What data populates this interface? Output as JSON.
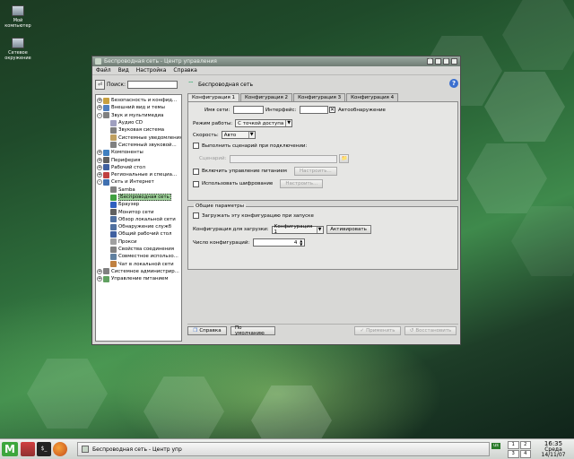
{
  "desktop": {
    "icons": [
      {
        "label": "Мой компьютер",
        "icon": "computer-icon"
      },
      {
        "label": "Сетевое окружение",
        "icon": "network-icon"
      }
    ]
  },
  "window": {
    "title": "Беспроводная сеть - Центр управления",
    "menu": [
      "Файл",
      "Вид",
      "Настройка",
      "Справка"
    ]
  },
  "sidebar": {
    "search_label": "Поиск:",
    "search_value": "",
    "tree": [
      {
        "label": "Безопасность и конфид...",
        "level": 1,
        "expander": "+",
        "icon_color": "#c8a040"
      },
      {
        "label": "Внешний вид и темы",
        "level": 1,
        "expander": "+",
        "icon_color": "#5080c0"
      },
      {
        "label": "Звук и мультимедиа",
        "level": 1,
        "expander": "-",
        "icon_color": "#808080"
      },
      {
        "label": "Аудио CD",
        "level": 2,
        "icon_color": "#a0a0c0"
      },
      {
        "label": "Звуковая система",
        "level": 2,
        "icon_color": "#808080"
      },
      {
        "label": "Системные уведомления",
        "level": 2,
        "icon_color": "#c0a060"
      },
      {
        "label": "Системный звуковой...",
        "level": 2,
        "icon_color": "#808080"
      },
      {
        "label": "Компоненты",
        "level": 1,
        "expander": "+",
        "icon_color": "#4080c0"
      },
      {
        "label": "Периферия",
        "level": 1,
        "expander": "+",
        "icon_color": "#606060"
      },
      {
        "label": "Рабочий стол",
        "level": 1,
        "expander": "+",
        "icon_color": "#4060a0"
      },
      {
        "label": "Региональные и специа...",
        "level": 1,
        "expander": "+",
        "icon_color": "#c04040"
      },
      {
        "label": "Сеть и Интернет",
        "level": 1,
        "expander": "-",
        "icon_color": "#4070b0"
      },
      {
        "label": "Samba",
        "level": 2,
        "icon_color": "#808080"
      },
      {
        "label": "Беспроводная сеть",
        "level": 2,
        "icon_color": "#40a040",
        "selected": true
      },
      {
        "label": "Браузер",
        "level": 2,
        "icon_color": "#3060c0"
      },
      {
        "label": "Монитор сети",
        "level": 2,
        "icon_color": "#606060"
      },
      {
        "label": "Обзор локальной сети",
        "level": 2,
        "icon_color": "#5070a0"
      },
      {
        "label": "Обнаружение служб",
        "level": 2,
        "icon_color": "#5070a0"
      },
      {
        "label": "Общий рабочий стол",
        "level": 2,
        "icon_color": "#4060a0"
      },
      {
        "label": "Прокси",
        "level": 2,
        "icon_color": "#a0a0a0"
      },
      {
        "label": "Свойства соединения",
        "level": 2,
        "icon_color": "#808080"
      },
      {
        "label": "Совместное использо...",
        "level": 2,
        "icon_color": "#6080a0"
      },
      {
        "label": "Чат в локальной сети",
        "level": 2,
        "icon_color": "#c08040"
      },
      {
        "label": "Системное администрир...",
        "level": 1,
        "expander": "+",
        "icon_color": "#808080"
      },
      {
        "label": "Управление питанием",
        "level": 1,
        "expander": "+",
        "icon_color": "#60a060"
      }
    ]
  },
  "main": {
    "header": "Беспроводная сеть",
    "help": "?",
    "tabs": [
      "Конфигурация 1",
      "Конфигурация 2",
      "Конфигурация 3",
      "Конфигурация 4"
    ],
    "fields": {
      "network_name_label": "Имя сети:",
      "network_name_value": "",
      "interface_label": "Интерфейс:",
      "interface_value": "",
      "autodetect_label": "Автообнаружение",
      "autodetect_checked": "✕",
      "mode_label": "Режим работы:",
      "mode_value": "С точкой доступа",
      "speed_label": "Скорость:",
      "speed_value": "Авто",
      "run_script_label": "Выполнить сценарий при подключении:",
      "script_label": "Сценарий:",
      "script_value": "",
      "power_label": "Включить управление питанием",
      "power_button": "Настроить...",
      "encryption_label": "Использовать шифрование",
      "encryption_button": "Настроить..."
    },
    "general": {
      "title": "Общие параметры",
      "load_label": "Загружать эту конфигурацию при запуске",
      "boot_config_label": "Конфигурация для загрузки:",
      "boot_config_value": "Конфигурация 1",
      "activate_button": "Активировать",
      "count_label": "Число конфигураций:",
      "count_value": "4"
    },
    "buttons": {
      "help": "Справка",
      "defaults": "По умолчанию",
      "apply": "Применить",
      "reset": "Восстановить"
    }
  },
  "taskbar": {
    "task_label": "Беспроводная сеть - Центр упр",
    "pager": [
      "1",
      "2",
      "3",
      "4"
    ],
    "layout": "us",
    "time": "16:35",
    "day": "Среда",
    "date": "14/11/07"
  }
}
